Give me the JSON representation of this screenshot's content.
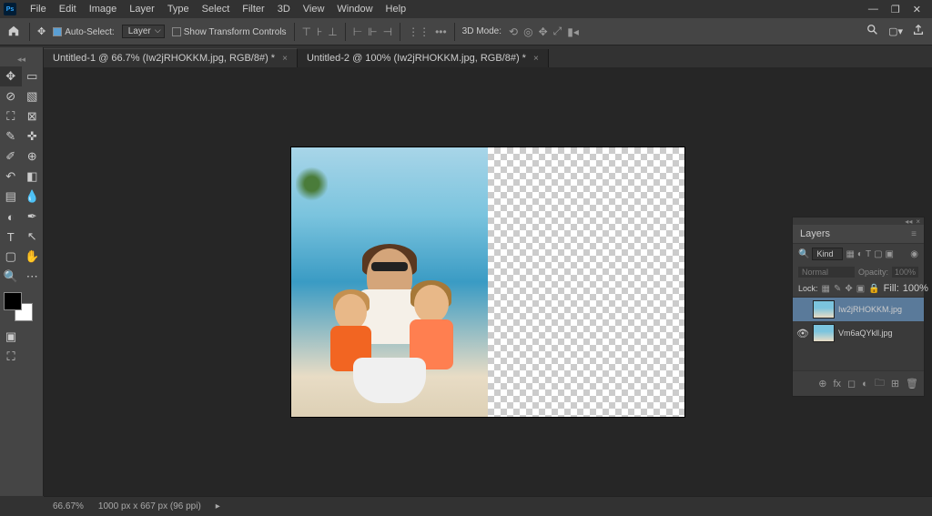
{
  "app": {
    "logo": "Ps"
  },
  "menu": [
    "File",
    "Edit",
    "Image",
    "Layer",
    "Type",
    "Select",
    "Filter",
    "3D",
    "View",
    "Window",
    "Help"
  ],
  "window_controls": {
    "min": "—",
    "restore": "❐",
    "close": "✕"
  },
  "options": {
    "auto_select_label": "Auto-Select:",
    "layer_dd": "Layer",
    "show_transform": "Show Transform Controls",
    "mode_label": "3D Mode:"
  },
  "tabs": [
    {
      "label": "Untitled-1 @ 66.7% (Iw2jRHOKKM.jpg, RGB/8#) *",
      "active": true
    },
    {
      "label": "Untitled-2 @ 100% (Iw2jRHOKKM.jpg, RGB/8#) *",
      "active": false
    }
  ],
  "layers_panel": {
    "title": "Layers",
    "filter_label": "Kind",
    "blend_mode": "Normal",
    "opacity_label": "Opacity:",
    "opacity_value": "100%",
    "lock_label": "Lock:",
    "fill_label": "Fill:",
    "fill_value": "100%",
    "layers": [
      {
        "name": "Iw2jRHOKKM.jpg",
        "visible": false,
        "selected": true
      },
      {
        "name": "Vm6aQYkll.jpg",
        "visible": true,
        "selected": false
      }
    ]
  },
  "status": {
    "zoom": "66.67%",
    "doc_info": "1000 px x 667 px (96 ppi)"
  }
}
